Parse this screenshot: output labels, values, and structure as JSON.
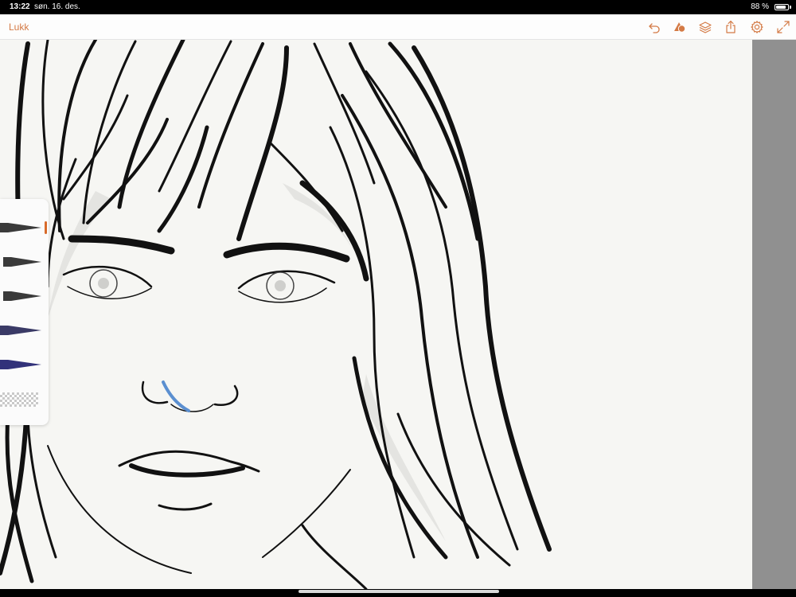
{
  "status_bar": {
    "time": "13:22",
    "date": "søn. 16. des.",
    "battery_text": "88 %",
    "battery_level": 0.88
  },
  "toolbar": {
    "close_label": "Lukk",
    "accent_color": "#d47a45",
    "icons": [
      "undo-icon",
      "shapes-icon",
      "layers-icon",
      "share-icon",
      "settings-icon",
      "fullscreen-icon"
    ]
  },
  "canvas": {
    "background_color": "#f6f6f3",
    "content": "line-art-portrait"
  },
  "brush_panel": {
    "brushes": [
      {
        "name": "brush-1",
        "color": "#3a3a3a"
      },
      {
        "name": "brush-2",
        "color": "#3a3a3a"
      },
      {
        "name": "brush-3",
        "color": "#3a3a3a"
      },
      {
        "name": "brush-4",
        "color": "#3a3a66"
      },
      {
        "name": "brush-5",
        "color": "#32327a"
      }
    ],
    "indicator_color": "#d86a2a",
    "texture": "checkerboard"
  }
}
